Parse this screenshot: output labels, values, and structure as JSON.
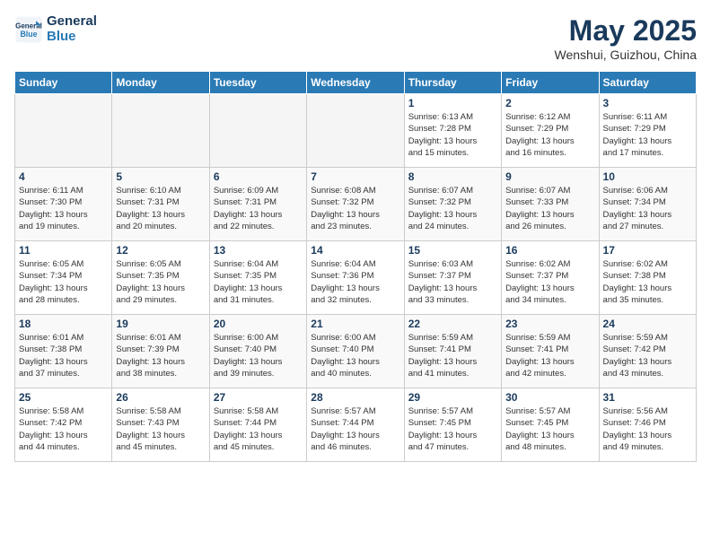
{
  "header": {
    "logo_line1": "General",
    "logo_line2": "Blue",
    "month_year": "May 2025",
    "location": "Wenshui, Guizhou, China"
  },
  "weekdays": [
    "Sunday",
    "Monday",
    "Tuesday",
    "Wednesday",
    "Thursday",
    "Friday",
    "Saturday"
  ],
  "weeks": [
    [
      {
        "day": "",
        "info": ""
      },
      {
        "day": "",
        "info": ""
      },
      {
        "day": "",
        "info": ""
      },
      {
        "day": "",
        "info": ""
      },
      {
        "day": "1",
        "info": "Sunrise: 6:13 AM\nSunset: 7:28 PM\nDaylight: 13 hours\nand 15 minutes."
      },
      {
        "day": "2",
        "info": "Sunrise: 6:12 AM\nSunset: 7:29 PM\nDaylight: 13 hours\nand 16 minutes."
      },
      {
        "day": "3",
        "info": "Sunrise: 6:11 AM\nSunset: 7:29 PM\nDaylight: 13 hours\nand 17 minutes."
      }
    ],
    [
      {
        "day": "4",
        "info": "Sunrise: 6:11 AM\nSunset: 7:30 PM\nDaylight: 13 hours\nand 19 minutes."
      },
      {
        "day": "5",
        "info": "Sunrise: 6:10 AM\nSunset: 7:31 PM\nDaylight: 13 hours\nand 20 minutes."
      },
      {
        "day": "6",
        "info": "Sunrise: 6:09 AM\nSunset: 7:31 PM\nDaylight: 13 hours\nand 22 minutes."
      },
      {
        "day": "7",
        "info": "Sunrise: 6:08 AM\nSunset: 7:32 PM\nDaylight: 13 hours\nand 23 minutes."
      },
      {
        "day": "8",
        "info": "Sunrise: 6:07 AM\nSunset: 7:32 PM\nDaylight: 13 hours\nand 24 minutes."
      },
      {
        "day": "9",
        "info": "Sunrise: 6:07 AM\nSunset: 7:33 PM\nDaylight: 13 hours\nand 26 minutes."
      },
      {
        "day": "10",
        "info": "Sunrise: 6:06 AM\nSunset: 7:34 PM\nDaylight: 13 hours\nand 27 minutes."
      }
    ],
    [
      {
        "day": "11",
        "info": "Sunrise: 6:05 AM\nSunset: 7:34 PM\nDaylight: 13 hours\nand 28 minutes."
      },
      {
        "day": "12",
        "info": "Sunrise: 6:05 AM\nSunset: 7:35 PM\nDaylight: 13 hours\nand 29 minutes."
      },
      {
        "day": "13",
        "info": "Sunrise: 6:04 AM\nSunset: 7:35 PM\nDaylight: 13 hours\nand 31 minutes."
      },
      {
        "day": "14",
        "info": "Sunrise: 6:04 AM\nSunset: 7:36 PM\nDaylight: 13 hours\nand 32 minutes."
      },
      {
        "day": "15",
        "info": "Sunrise: 6:03 AM\nSunset: 7:37 PM\nDaylight: 13 hours\nand 33 minutes."
      },
      {
        "day": "16",
        "info": "Sunrise: 6:02 AM\nSunset: 7:37 PM\nDaylight: 13 hours\nand 34 minutes."
      },
      {
        "day": "17",
        "info": "Sunrise: 6:02 AM\nSunset: 7:38 PM\nDaylight: 13 hours\nand 35 minutes."
      }
    ],
    [
      {
        "day": "18",
        "info": "Sunrise: 6:01 AM\nSunset: 7:38 PM\nDaylight: 13 hours\nand 37 minutes."
      },
      {
        "day": "19",
        "info": "Sunrise: 6:01 AM\nSunset: 7:39 PM\nDaylight: 13 hours\nand 38 minutes."
      },
      {
        "day": "20",
        "info": "Sunrise: 6:00 AM\nSunset: 7:40 PM\nDaylight: 13 hours\nand 39 minutes."
      },
      {
        "day": "21",
        "info": "Sunrise: 6:00 AM\nSunset: 7:40 PM\nDaylight: 13 hours\nand 40 minutes."
      },
      {
        "day": "22",
        "info": "Sunrise: 5:59 AM\nSunset: 7:41 PM\nDaylight: 13 hours\nand 41 minutes."
      },
      {
        "day": "23",
        "info": "Sunrise: 5:59 AM\nSunset: 7:41 PM\nDaylight: 13 hours\nand 42 minutes."
      },
      {
        "day": "24",
        "info": "Sunrise: 5:59 AM\nSunset: 7:42 PM\nDaylight: 13 hours\nand 43 minutes."
      }
    ],
    [
      {
        "day": "25",
        "info": "Sunrise: 5:58 AM\nSunset: 7:42 PM\nDaylight: 13 hours\nand 44 minutes."
      },
      {
        "day": "26",
        "info": "Sunrise: 5:58 AM\nSunset: 7:43 PM\nDaylight: 13 hours\nand 45 minutes."
      },
      {
        "day": "27",
        "info": "Sunrise: 5:58 AM\nSunset: 7:44 PM\nDaylight: 13 hours\nand 45 minutes."
      },
      {
        "day": "28",
        "info": "Sunrise: 5:57 AM\nSunset: 7:44 PM\nDaylight: 13 hours\nand 46 minutes."
      },
      {
        "day": "29",
        "info": "Sunrise: 5:57 AM\nSunset: 7:45 PM\nDaylight: 13 hours\nand 47 minutes."
      },
      {
        "day": "30",
        "info": "Sunrise: 5:57 AM\nSunset: 7:45 PM\nDaylight: 13 hours\nand 48 minutes."
      },
      {
        "day": "31",
        "info": "Sunrise: 5:56 AM\nSunset: 7:46 PM\nDaylight: 13 hours\nand 49 minutes."
      }
    ]
  ]
}
